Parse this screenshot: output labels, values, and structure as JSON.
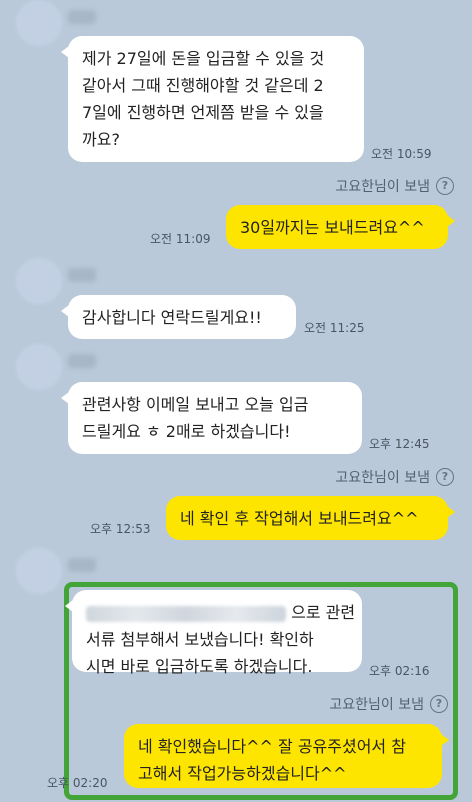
{
  "messages": [
    {
      "text": "제가 27일에 돈을 입금할 수 있을 것\n같아서 그때 진행해야할 것 같은데 2\n7일에 진행하면 언제쯤 받을 수 있을\n까요?",
      "time": "오전 10:59"
    },
    {
      "sender": "고요한님이 보냄",
      "help_icon": "?"
    },
    {
      "text": "30일까지는 보내드려요^^",
      "time": "오전 11:09"
    },
    {
      "text": "감사합니다 연락드릴게요!!",
      "time": "오전 11:25"
    },
    {
      "text": "관련사항 이메일 보내고 오늘 입금\n드릴게요 ㅎ 2매로 하겠습니다!",
      "time": "오후 12:45"
    },
    {
      "sender": "고요한님이 보냄",
      "help_icon": "?"
    },
    {
      "text": "네 확인 후 작업해서 보내드려요^^",
      "time": "오후 12:53"
    },
    {
      "text_first": "으로 관련",
      "text_rest": "서류 첨부해서 보냈습니다! 확인하\n시면 바로 입금하도록 하겠습니다.",
      "time": "오후 02:16"
    },
    {
      "sender": "고요한님이 보냄",
      "help_icon": "?"
    },
    {
      "text": "네 확인했습니다^^ 잘 공유주셨어서 참\n고해서 작업가능하겠습니다^^",
      "time": "오후 02:20"
    }
  ],
  "colors": {
    "background": "#b9c9da",
    "my_bubble": "#fee500",
    "other_bubble": "#ffffff",
    "highlight": "#43a437"
  }
}
